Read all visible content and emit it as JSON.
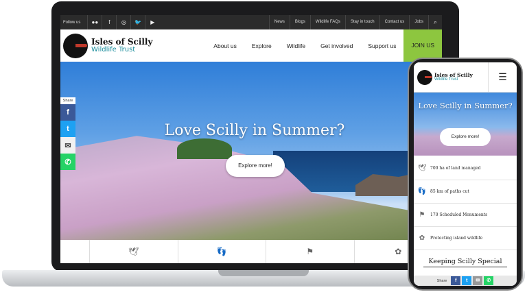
{
  "topbar": {
    "follow_label": "Follow us",
    "social_icons": [
      "flickr-icon",
      "facebook-icon",
      "instagram-icon",
      "twitter-icon",
      "youtube-icon"
    ],
    "links": [
      "News",
      "Blogs",
      "Wildlife FAQs",
      "Stay in touch",
      "Contact us",
      "Jobs"
    ]
  },
  "brand": {
    "line1": "Isles of Scilly",
    "line2": "Wildlife Trust"
  },
  "nav": {
    "items": [
      "About us",
      "Explore",
      "Wildlife",
      "Get involved",
      "Support us"
    ],
    "join": "JOIN US"
  },
  "hero": {
    "title": "Love Scilly in Summer?",
    "button": "Explore more!"
  },
  "share": {
    "label": "Share"
  },
  "phone": {
    "hero_title": "Love Scilly in Summer?",
    "hero_button": "Explore more!",
    "stats": [
      "700 ha of land managed",
      "85 km of paths cut",
      "170 Scheduled Monuments",
      "Protecting island wildlife"
    ],
    "heading": "Keeping Scilly Special",
    "share_label": "Share"
  },
  "colors": {
    "accent_green": "#8dc63f",
    "brand_teal": "#1a8d9c",
    "topbar": "#2b2b2b"
  }
}
